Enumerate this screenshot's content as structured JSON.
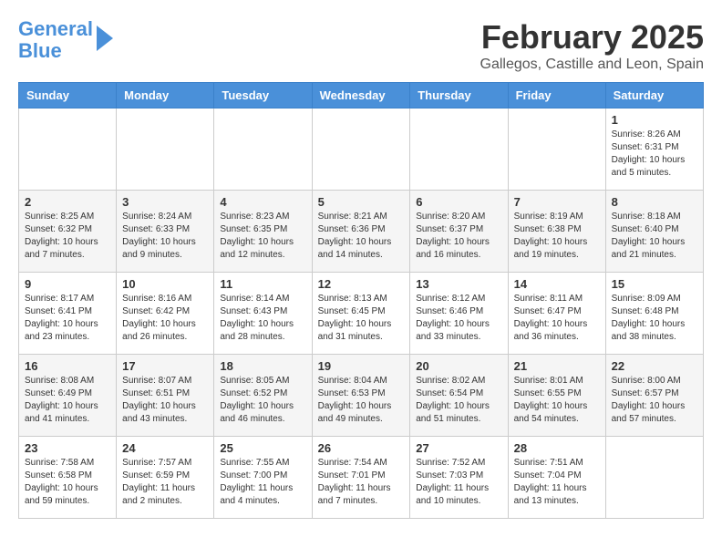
{
  "header": {
    "logo_line1": "General",
    "logo_line2": "Blue",
    "month_title": "February 2025",
    "location": "Gallegos, Castille and Leon, Spain"
  },
  "weekdays": [
    "Sunday",
    "Monday",
    "Tuesday",
    "Wednesday",
    "Thursday",
    "Friday",
    "Saturday"
  ],
  "weeks": [
    [
      {
        "day": "",
        "info": ""
      },
      {
        "day": "",
        "info": ""
      },
      {
        "day": "",
        "info": ""
      },
      {
        "day": "",
        "info": ""
      },
      {
        "day": "",
        "info": ""
      },
      {
        "day": "",
        "info": ""
      },
      {
        "day": "1",
        "info": "Sunrise: 8:26 AM\nSunset: 6:31 PM\nDaylight: 10 hours\nand 5 minutes."
      }
    ],
    [
      {
        "day": "2",
        "info": "Sunrise: 8:25 AM\nSunset: 6:32 PM\nDaylight: 10 hours\nand 7 minutes."
      },
      {
        "day": "3",
        "info": "Sunrise: 8:24 AM\nSunset: 6:33 PM\nDaylight: 10 hours\nand 9 minutes."
      },
      {
        "day": "4",
        "info": "Sunrise: 8:23 AM\nSunset: 6:35 PM\nDaylight: 10 hours\nand 12 minutes."
      },
      {
        "day": "5",
        "info": "Sunrise: 8:21 AM\nSunset: 6:36 PM\nDaylight: 10 hours\nand 14 minutes."
      },
      {
        "day": "6",
        "info": "Sunrise: 8:20 AM\nSunset: 6:37 PM\nDaylight: 10 hours\nand 16 minutes."
      },
      {
        "day": "7",
        "info": "Sunrise: 8:19 AM\nSunset: 6:38 PM\nDaylight: 10 hours\nand 19 minutes."
      },
      {
        "day": "8",
        "info": "Sunrise: 8:18 AM\nSunset: 6:40 PM\nDaylight: 10 hours\nand 21 minutes."
      }
    ],
    [
      {
        "day": "9",
        "info": "Sunrise: 8:17 AM\nSunset: 6:41 PM\nDaylight: 10 hours\nand 23 minutes."
      },
      {
        "day": "10",
        "info": "Sunrise: 8:16 AM\nSunset: 6:42 PM\nDaylight: 10 hours\nand 26 minutes."
      },
      {
        "day": "11",
        "info": "Sunrise: 8:14 AM\nSunset: 6:43 PM\nDaylight: 10 hours\nand 28 minutes."
      },
      {
        "day": "12",
        "info": "Sunrise: 8:13 AM\nSunset: 6:45 PM\nDaylight: 10 hours\nand 31 minutes."
      },
      {
        "day": "13",
        "info": "Sunrise: 8:12 AM\nSunset: 6:46 PM\nDaylight: 10 hours\nand 33 minutes."
      },
      {
        "day": "14",
        "info": "Sunrise: 8:11 AM\nSunset: 6:47 PM\nDaylight: 10 hours\nand 36 minutes."
      },
      {
        "day": "15",
        "info": "Sunrise: 8:09 AM\nSunset: 6:48 PM\nDaylight: 10 hours\nand 38 minutes."
      }
    ],
    [
      {
        "day": "16",
        "info": "Sunrise: 8:08 AM\nSunset: 6:49 PM\nDaylight: 10 hours\nand 41 minutes."
      },
      {
        "day": "17",
        "info": "Sunrise: 8:07 AM\nSunset: 6:51 PM\nDaylight: 10 hours\nand 43 minutes."
      },
      {
        "day": "18",
        "info": "Sunrise: 8:05 AM\nSunset: 6:52 PM\nDaylight: 10 hours\nand 46 minutes."
      },
      {
        "day": "19",
        "info": "Sunrise: 8:04 AM\nSunset: 6:53 PM\nDaylight: 10 hours\nand 49 minutes."
      },
      {
        "day": "20",
        "info": "Sunrise: 8:02 AM\nSunset: 6:54 PM\nDaylight: 10 hours\nand 51 minutes."
      },
      {
        "day": "21",
        "info": "Sunrise: 8:01 AM\nSunset: 6:55 PM\nDaylight: 10 hours\nand 54 minutes."
      },
      {
        "day": "22",
        "info": "Sunrise: 8:00 AM\nSunset: 6:57 PM\nDaylight: 10 hours\nand 57 minutes."
      }
    ],
    [
      {
        "day": "23",
        "info": "Sunrise: 7:58 AM\nSunset: 6:58 PM\nDaylight: 10 hours\nand 59 minutes."
      },
      {
        "day": "24",
        "info": "Sunrise: 7:57 AM\nSunset: 6:59 PM\nDaylight: 11 hours\nand 2 minutes."
      },
      {
        "day": "25",
        "info": "Sunrise: 7:55 AM\nSunset: 7:00 PM\nDaylight: 11 hours\nand 4 minutes."
      },
      {
        "day": "26",
        "info": "Sunrise: 7:54 AM\nSunset: 7:01 PM\nDaylight: 11 hours\nand 7 minutes."
      },
      {
        "day": "27",
        "info": "Sunrise: 7:52 AM\nSunset: 7:03 PM\nDaylight: 11 hours\nand 10 minutes."
      },
      {
        "day": "28",
        "info": "Sunrise: 7:51 AM\nSunset: 7:04 PM\nDaylight: 11 hours\nand 13 minutes."
      },
      {
        "day": "",
        "info": ""
      }
    ]
  ]
}
